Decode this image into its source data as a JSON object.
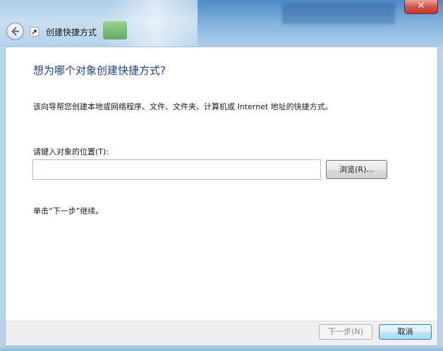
{
  "window": {
    "title": "创建快捷方式",
    "close_glyph": "✕"
  },
  "main": {
    "heading": "想为哪个对象创建快捷方式?",
    "description": "该向导帮您创建本地或网络程序、文件、文件夹、计算机或 Internet 地址的快捷方式。",
    "location_label": "请键入对象的位置(T):",
    "location_value": "",
    "browse_label": "浏览(R)...",
    "hint": "单击“下一步”继续。"
  },
  "footer": {
    "next_label": "下一步(N)",
    "cancel_label": "取消"
  },
  "colors": {
    "heading": "#1e3f8f",
    "accent": "#3c7fb1"
  },
  "icons": {
    "back": "back-arrow-icon",
    "shortcut": "shortcut-icon",
    "close": "close-icon"
  }
}
